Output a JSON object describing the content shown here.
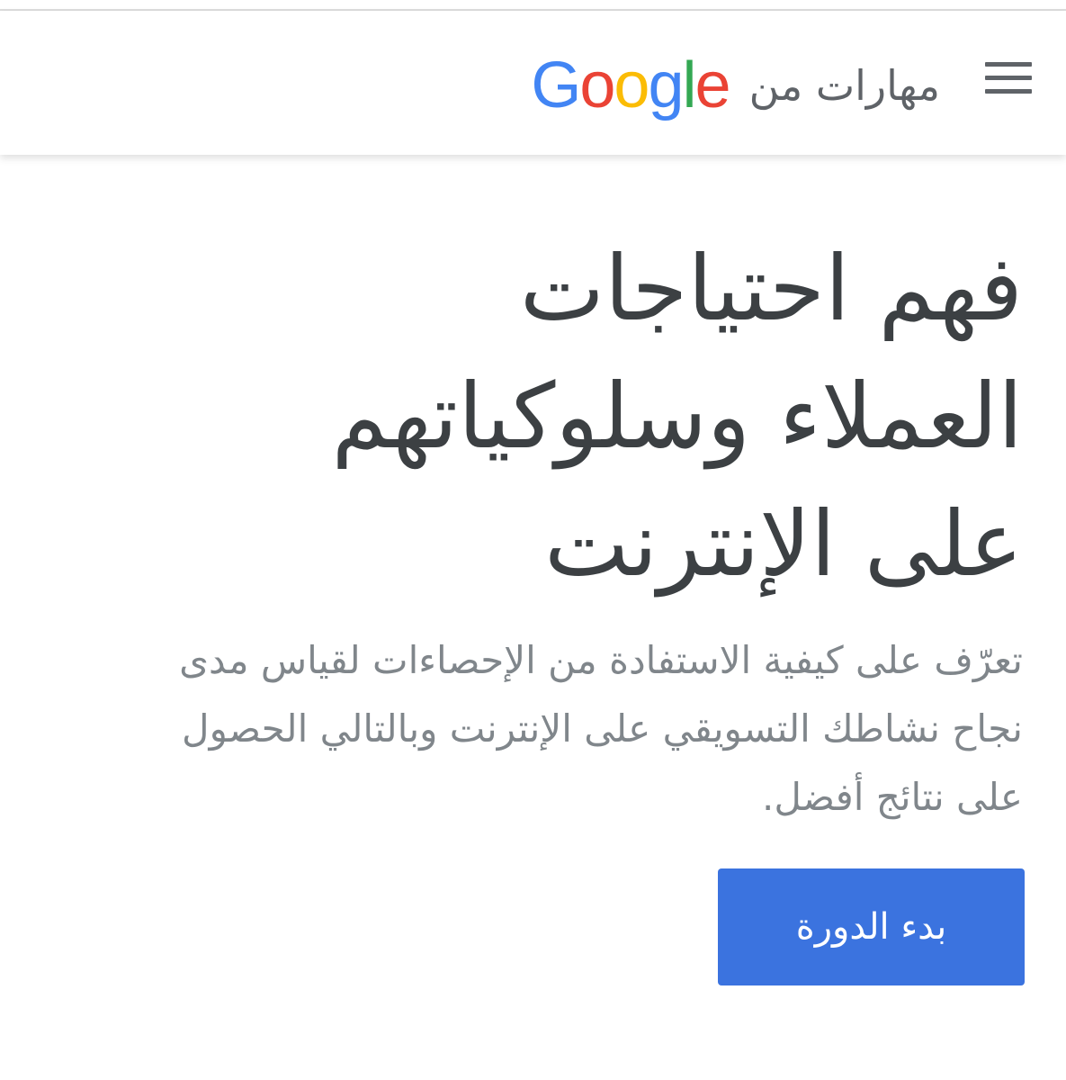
{
  "header": {
    "menu_icon": "hamburger-menu-icon",
    "brand_text": "مهارات من",
    "logo": {
      "letters": [
        "G",
        "o",
        "o",
        "g",
        "l",
        "e"
      ],
      "colors": [
        "#4285F4",
        "#EA4335",
        "#FBBC05",
        "#4285F4",
        "#34A853",
        "#EA4335"
      ]
    }
  },
  "main": {
    "headline_lines": [
      "فهم احتياجات",
      "العملاء وسلوكياتهم",
      "على الإنترنت"
    ],
    "subtitle_lines": [
      "تعرّف على كيفية الاستفادة من الإحصاءات لقياس مدى",
      "نجاح نشاطك التسويقي على الإنترنت وبالتالي الحصول",
      "على نتائج أفضل."
    ],
    "cta_label": "بدء الدورة"
  },
  "colors": {
    "accent": "#3b73df",
    "heading_text": "#3c4043",
    "body_text": "#80868b",
    "icon": "#5f6368"
  }
}
